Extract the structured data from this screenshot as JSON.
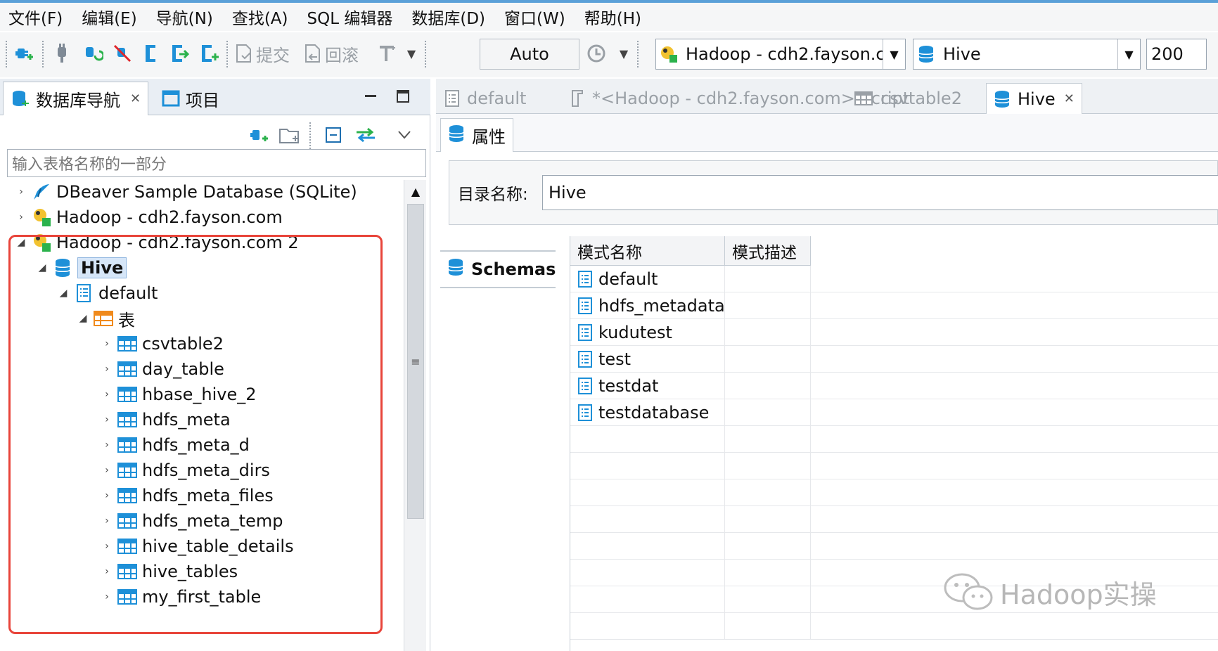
{
  "menubar": {
    "items": [
      "文件(F)",
      "编辑(E)",
      "导航(N)",
      "查找(A)",
      "SQL 编辑器",
      "数据库(D)",
      "窗口(W)",
      "帮助(H)"
    ]
  },
  "toolbar": {
    "commit_label": "提交",
    "rollback_label": "回滚",
    "transaction_mode": "Auto",
    "connection_value": "Hadoop - cdh2.fayson.c",
    "database_value": "Hive",
    "result_limit": "200"
  },
  "navigator": {
    "tab_db": "数据库导航",
    "tab_projects": "项目",
    "filter_placeholder": "输入表格名称的一部分",
    "tree": [
      {
        "label": "DBeaver Sample Database (SQLite)",
        "icon": "sqlite-icon",
        "twisty": "›"
      },
      {
        "label": "Hadoop - cdh2.fayson.com",
        "icon": "hadoop-icon",
        "twisty": "›"
      },
      {
        "label": "Hadoop - cdh2.fayson.com 2",
        "icon": "hadoop-icon",
        "twisty": "◢"
      },
      {
        "label": "Hive",
        "icon": "database-icon",
        "twisty": "◢"
      },
      {
        "label": "default",
        "icon": "schema-icon",
        "twisty": "◢"
      },
      {
        "label": "表",
        "icon": "tables-folder-icon",
        "twisty": "◢"
      },
      {
        "label": "csvtable2",
        "icon": "table-icon",
        "twisty": "›"
      },
      {
        "label": "day_table",
        "icon": "table-icon",
        "twisty": "›"
      },
      {
        "label": "hbase_hive_2",
        "icon": "table-icon",
        "twisty": "›"
      },
      {
        "label": "hdfs_meta",
        "icon": "table-icon",
        "twisty": "›"
      },
      {
        "label": "hdfs_meta_d",
        "icon": "table-icon",
        "twisty": "›"
      },
      {
        "label": "hdfs_meta_dirs",
        "icon": "table-icon",
        "twisty": "›"
      },
      {
        "label": "hdfs_meta_files",
        "icon": "table-icon",
        "twisty": "›"
      },
      {
        "label": "hdfs_meta_temp",
        "icon": "table-icon",
        "twisty": "›"
      },
      {
        "label": "hive_table_details",
        "icon": "table-icon",
        "twisty": "›"
      },
      {
        "label": "hive_tables",
        "icon": "table-icon",
        "twisty": "›"
      },
      {
        "label": "my_first_table",
        "icon": "table-icon",
        "twisty": "›"
      }
    ]
  },
  "editor": {
    "tabs": [
      {
        "label": "default",
        "icon": "schema-icon"
      },
      {
        "label": "*<Hadoop - cdh2.fayson.com> Script",
        "icon": "script-icon"
      },
      {
        "label": "csvtable2",
        "icon": "table-icon"
      },
      {
        "label": "Hive",
        "icon": "database-icon"
      }
    ],
    "subtab": "属性",
    "catalog_label": "目录名称:",
    "catalog_value": "Hive",
    "schemas_tab": "Schemas",
    "columns": [
      "模式名称",
      "模式描述"
    ],
    "rows": [
      "default",
      "hdfs_metadata",
      "kudutest",
      "test",
      "testdat",
      "testdatabase"
    ]
  },
  "watermark": "Hadoop实操",
  "colors": {
    "accent": "#1e90d8",
    "highlight_box": "#e8443a",
    "selection": "#d6e6f8"
  }
}
